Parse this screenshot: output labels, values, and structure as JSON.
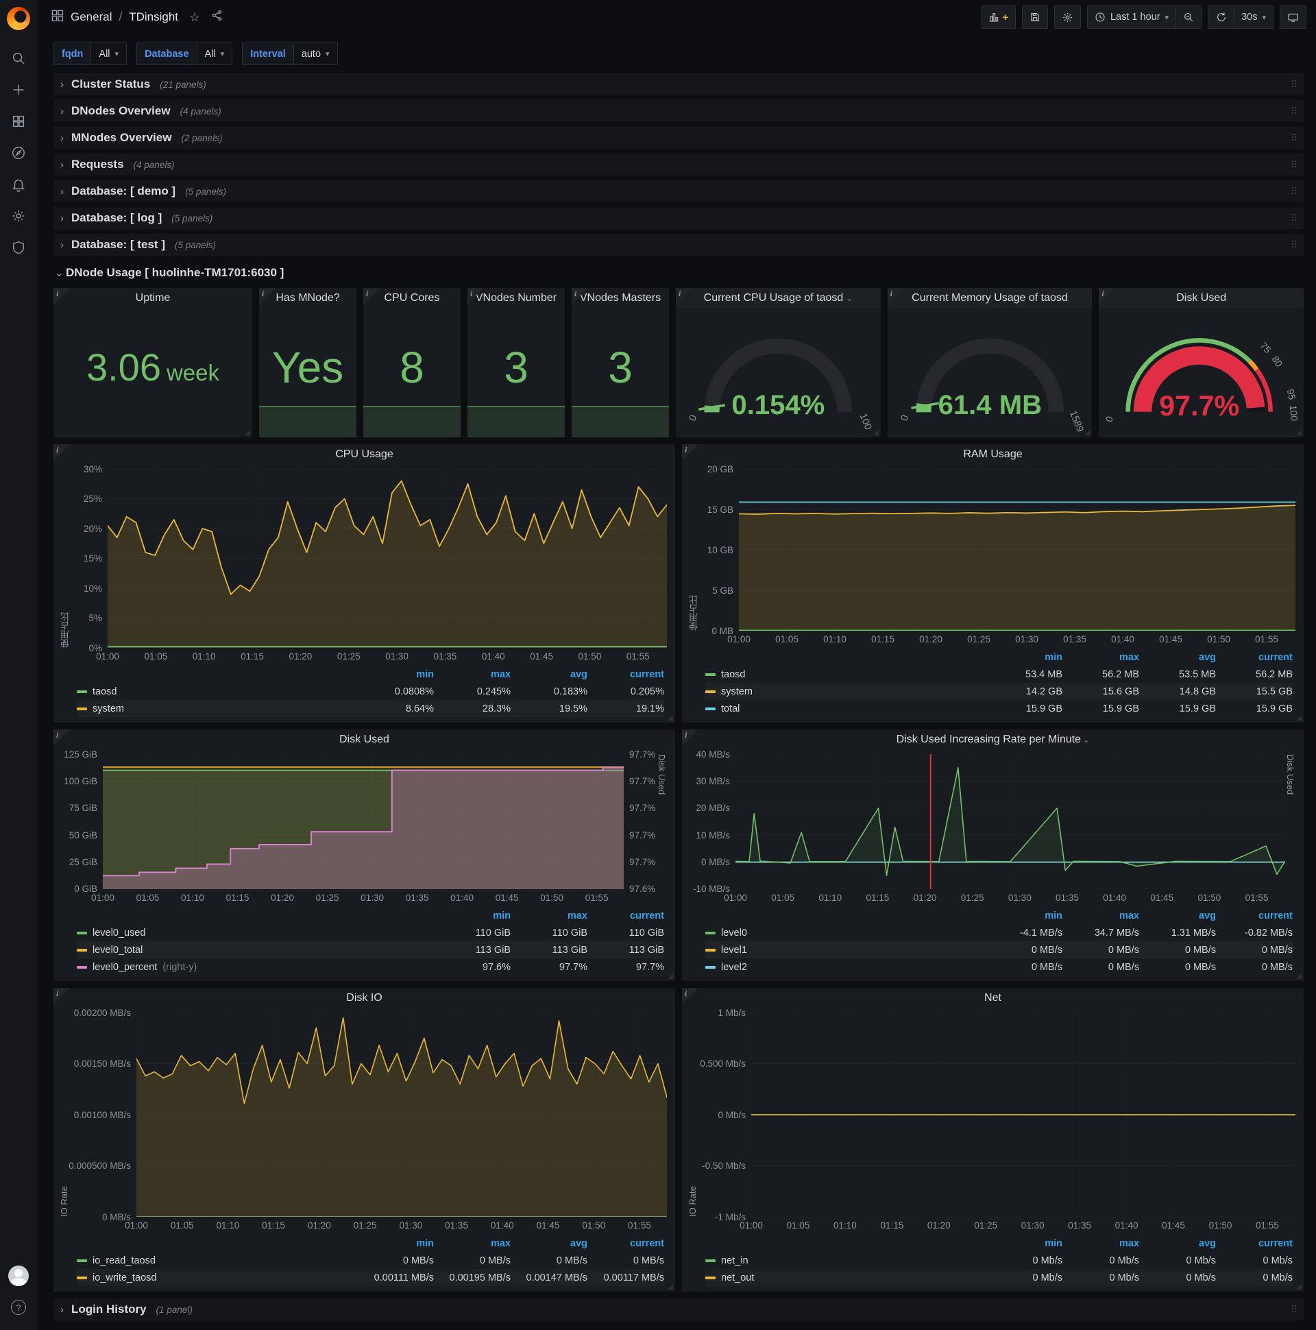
{
  "topbar": {
    "breadcrumb": {
      "section": "General",
      "separator": "/",
      "page": "TDinsight"
    },
    "time_range": "Last 1 hour",
    "refresh_interval": "30s"
  },
  "variables": [
    {
      "label": "fqdn",
      "value": "All"
    },
    {
      "label": "Database",
      "value": "All"
    },
    {
      "label": "Interval",
      "value": "auto"
    }
  ],
  "rows": [
    {
      "title": "Cluster Status",
      "count": "(21 panels)"
    },
    {
      "title": "DNodes Overview",
      "count": "(4 panels)"
    },
    {
      "title": "MNodes Overview",
      "count": "(2 panels)"
    },
    {
      "title": "Requests",
      "count": "(4 panels)"
    },
    {
      "title": "Database: [ demo ]",
      "count": "(5 panels)"
    },
    {
      "title": "Database: [ log ]",
      "count": "(5 panels)"
    },
    {
      "title": "Database: [ test ]",
      "count": "(5 panels)"
    }
  ],
  "dnode_row": {
    "title": "DNode Usage [ huolinhe-TM1701:6030 ]"
  },
  "login_row": {
    "title": "Login History",
    "count": "(1 panel)"
  },
  "stats": [
    {
      "title": "Uptime",
      "value": "3.06",
      "unit": "week"
    },
    {
      "title": "Has MNode?",
      "value": "Yes"
    },
    {
      "title": "CPU Cores",
      "value": "8"
    },
    {
      "title": "VNodes Number",
      "value": "3"
    },
    {
      "title": "VNodes Masters",
      "value": "3"
    }
  ],
  "gauges": [
    {
      "title": "Current CPU Usage of taosd",
      "value": "0.154%",
      "scale": [
        "0",
        "100"
      ],
      "color": "#73bf69"
    },
    {
      "title": "Current Memory Usage of taosd",
      "value": "61.4 MB",
      "scale": [
        "0",
        "1589"
      ],
      "color": "#73bf69"
    },
    {
      "title": "Disk Used",
      "value": "97.7%",
      "scale": [
        "0",
        "75",
        "80",
        "95",
        "100"
      ],
      "color": "#e02f44"
    }
  ],
  "legend_headers": [
    "min",
    "max",
    "avg",
    "current"
  ],
  "xticks": [
    "01:00",
    "01:05",
    "01:10",
    "01:15",
    "01:20",
    "01:25",
    "01:30",
    "01:35",
    "01:40",
    "01:45",
    "01:50",
    "01:55"
  ],
  "colors": {
    "green": "#73bf69",
    "yellow": "#eab839",
    "blue": "#6ed0e0",
    "magenta": "#d683ce",
    "red": "#e02f44",
    "link_blue": "#33a2e5"
  },
  "chart_data": [
    {
      "id": "cpu",
      "type": "line",
      "title": "CPU Usage",
      "ylabel": "使用占比",
      "yticks": [
        "30%",
        "25%",
        "20%",
        "15%",
        "10%",
        "5%",
        "0%"
      ],
      "ylim": [
        0,
        30
      ],
      "series": [
        {
          "name": "system",
          "color": "#eab839",
          "width": 1.8,
          "fill": 0.16,
          "values": [
            20.5,
            18.5,
            22,
            21,
            16,
            15.5,
            19,
            21.5,
            18,
            16.5,
            20,
            19.5,
            13.5,
            9,
            10.5,
            9.5,
            12,
            16.5,
            18.5,
            24.5,
            20,
            16,
            21,
            19.5,
            23.5,
            25,
            20.5,
            19,
            22,
            17.5,
            26,
            28,
            24,
            20.5,
            21.5,
            17,
            20,
            23.5,
            27.5,
            22,
            19,
            21,
            25.5,
            19.5,
            18,
            22.5,
            17.5,
            21,
            24.5,
            20,
            26.5,
            22,
            18.5,
            21,
            23.5,
            20.5,
            27,
            25,
            22,
            24
          ]
        },
        {
          "name": "taosd",
          "color": "#73bf69",
          "width": 1.8,
          "fill": 0.12,
          "values": [
            0.2,
            0.2
          ]
        }
      ],
      "legend": {
        "rows": [
          {
            "name": "taosd",
            "color": "#73bf69",
            "values": [
              "0.0808%",
              "0.245%",
              "0.183%",
              "0.205%"
            ]
          },
          {
            "name": "system",
            "color": "#eab839",
            "values": [
              "8.64%",
              "28.3%",
              "19.5%",
              "19.1%"
            ]
          }
        ]
      }
    },
    {
      "id": "ram",
      "type": "line",
      "title": "RAM Usage",
      "ylabel": "使用占比",
      "yticks": [
        "20 GB",
        "15 GB",
        "10 GB",
        "5 GB",
        "0 MB"
      ],
      "ylim": [
        0,
        20
      ],
      "series": [
        {
          "name": "system",
          "color": "#eab839",
          "width": 1.8,
          "fill": 0.16,
          "values": [
            14.45,
            14.4,
            14.5,
            14.45,
            14.5,
            14.42,
            14.48,
            14.52,
            14.47,
            14.5,
            14.55,
            14.5,
            14.58,
            14.52,
            14.6,
            14.55,
            14.62,
            14.68,
            14.6,
            14.72,
            14.78,
            14.72,
            14.82,
            14.9,
            14.98,
            15.05,
            15.15,
            15.28,
            15.42,
            15.5
          ]
        },
        {
          "name": "total",
          "color": "#6ed0e0",
          "width": 1.8,
          "fill": 0,
          "values": [
            15.9,
            15.9
          ]
        },
        {
          "name": "taosd",
          "color": "#73bf69",
          "width": 1.8,
          "fill": 0,
          "values": [
            0.05,
            0.05
          ]
        }
      ],
      "legend": {
        "rows": [
          {
            "name": "taosd",
            "color": "#73bf69",
            "values": [
              "53.4 MB",
              "56.2 MB",
              "53.5 MB",
              "56.2 MB"
            ]
          },
          {
            "name": "system",
            "color": "#eab839",
            "values": [
              "14.2 GB",
              "15.6 GB",
              "14.8 GB",
              "15.5 GB"
            ]
          },
          {
            "name": "total",
            "color": "#6ed0e0",
            "values": [
              "15.9 GB",
              "15.9 GB",
              "15.9 GB",
              "15.9 GB"
            ]
          }
        ]
      }
    },
    {
      "id": "disk",
      "type": "line",
      "title": "Disk Used",
      "yticks": [
        "125 GiB",
        "100 GiB",
        "75 GiB",
        "50 GiB",
        "25 GiB",
        "0 GiB"
      ],
      "yticks_right": [
        "97.7%",
        "97.7%",
        "97.7%",
        "97.7%",
        "97.7%",
        "97.6%"
      ],
      "ylabel_right": "Disk Used",
      "ylim": [
        0,
        125
      ],
      "series": [
        {
          "name": "level0_total",
          "color": "#eab839",
          "width": 1.8,
          "fill": 0.16,
          "values": [
            113,
            113
          ]
        },
        {
          "name": "level0_used",
          "color": "#73bf69",
          "width": 1.8,
          "fill": 0.16,
          "values": [
            110,
            110
          ]
        },
        {
          "name": "level0_percent",
          "color": "#d683ce",
          "width": 2,
          "fill": 0.3,
          "norm": true,
          "points": [
            [
              0,
              0.1
            ],
            [
              0.07,
              0.1
            ],
            [
              0.07,
              0.125
            ],
            [
              0.14,
              0.125
            ],
            [
              0.14,
              0.155
            ],
            [
              0.2,
              0.155
            ],
            [
              0.2,
              0.185
            ],
            [
              0.245,
              0.185
            ],
            [
              0.245,
              0.3
            ],
            [
              0.3,
              0.3
            ],
            [
              0.3,
              0.33
            ],
            [
              0.4,
              0.33
            ],
            [
              0.4,
              0.425
            ],
            [
              0.555,
              0.425
            ],
            [
              0.555,
              0.88
            ],
            [
              0.96,
              0.88
            ],
            [
              0.96,
              0.9
            ],
            [
              1,
              0.9
            ]
          ]
        }
      ],
      "legend": {
        "cols": [
          "min",
          "max",
          "current"
        ],
        "rows": [
          {
            "name": "level0_used",
            "color": "#73bf69",
            "values": [
              "110 GiB",
              "110 GiB",
              "110 GiB"
            ]
          },
          {
            "name": "level0_total",
            "color": "#eab839",
            "values": [
              "113 GiB",
              "113 GiB",
              "113 GiB"
            ]
          },
          {
            "name": "level0_percent",
            "suffix": "(right-y)",
            "color": "#d683ce",
            "values": [
              "97.6%",
              "97.7%",
              "97.7%"
            ]
          }
        ]
      }
    },
    {
      "id": "rate",
      "type": "line",
      "title": "Disk Used Increasing Rate per Minute",
      "has_menu": true,
      "yticks": [
        "40 MB/s",
        "30 MB/s",
        "20 MB/s",
        "10 MB/s",
        "0 MB/s",
        "-10 MB/s"
      ],
      "ylabel_right": "Disk Used",
      "ylim": [
        -10,
        40
      ],
      "annotations": [
        {
          "x": 0.355,
          "color": "#e02f44"
        }
      ],
      "series": [
        {
          "name": "level1",
          "color": "#eab839",
          "width": 1.6,
          "fill": 0,
          "values": [
            0,
            0
          ]
        },
        {
          "name": "level2",
          "color": "#6ed0e0",
          "width": 1.6,
          "fill": 0,
          "values": [
            0,
            0
          ]
        },
        {
          "name": "level0",
          "color": "#73bf69",
          "width": 1.6,
          "fill": 0.1,
          "points": [
            [
              0,
              0.3
            ],
            [
              0.025,
              0.2
            ],
            [
              0.034,
              18
            ],
            [
              0.045,
              0.4
            ],
            [
              0.1,
              -0.3
            ],
            [
              0.12,
              11
            ],
            [
              0.135,
              0.2
            ],
            [
              0.2,
              0.2
            ],
            [
              0.26,
              20
            ],
            [
              0.275,
              -5
            ],
            [
              0.29,
              13
            ],
            [
              0.305,
              0.3
            ],
            [
              0.37,
              0.2
            ],
            [
              0.405,
              35
            ],
            [
              0.42,
              0.3
            ],
            [
              0.5,
              0.2
            ],
            [
              0.585,
              20
            ],
            [
              0.6,
              -3
            ],
            [
              0.615,
              0.3
            ],
            [
              0.7,
              0.2
            ],
            [
              0.73,
              -1.5
            ],
            [
              0.8,
              0.3
            ],
            [
              0.9,
              0.2
            ],
            [
              0.965,
              6
            ],
            [
              0.985,
              -4.5
            ],
            [
              1,
              0.4
            ]
          ]
        }
      ],
      "legend": {
        "rows": [
          {
            "name": "level0",
            "color": "#73bf69",
            "values": [
              "-4.1 MB/s",
              "34.7 MB/s",
              "1.31 MB/s",
              "-0.82 MB/s"
            ]
          },
          {
            "name": "level1",
            "color": "#eab839",
            "values": [
              "0 MB/s",
              "0 MB/s",
              "0 MB/s",
              "0 MB/s"
            ]
          },
          {
            "name": "level2",
            "color": "#6ed0e0",
            "values": [
              "0 MB/s",
              "0 MB/s",
              "0 MB/s",
              "0 MB/s"
            ]
          }
        ]
      }
    },
    {
      "id": "io",
      "type": "line",
      "title": "Disk IO",
      "ylabel": "IO Rate",
      "yticks": [
        "0.00200 MB/s",
        "0.00150 MB/s",
        "0.00100 MB/s",
        "0.000500 MB/s",
        "0 MB/s"
      ],
      "ylim": [
        0,
        0.002
      ],
      "series": [
        {
          "name": "io_write_taosd",
          "color": "#eab839",
          "width": 1.6,
          "fill": 0.16,
          "values": [
            0.00155,
            0.00138,
            0.00142,
            0.00136,
            0.0014,
            0.00158,
            0.00148,
            0.00152,
            0.00143,
            0.00156,
            0.00149,
            0.0016,
            0.00111,
            0.00145,
            0.00168,
            0.00132,
            0.00154,
            0.00126,
            0.00161,
            0.0015,
            0.00185,
            0.00138,
            0.00148,
            0.00195,
            0.0013,
            0.0015,
            0.00139,
            0.00168,
            0.00142,
            0.0016,
            0.00133,
            0.00152,
            0.00175,
            0.00141,
            0.00154,
            0.00148,
            0.0013,
            0.00158,
            0.00145,
            0.00168,
            0.00137,
            0.0015,
            0.0016,
            0.00128,
            0.00148,
            0.00155,
            0.00135,
            0.00192,
            0.00145,
            0.0013,
            0.00156,
            0.0015,
            0.0014,
            0.00162,
            0.00148,
            0.00135,
            0.00158,
            0.00132,
            0.0015,
            0.00117
          ]
        },
        {
          "name": "io_read_taosd",
          "color": "#73bf69",
          "width": 1.6,
          "fill": 0,
          "values": [
            0,
            0
          ]
        }
      ],
      "legend": {
        "rows": [
          {
            "name": "io_read_taosd",
            "color": "#73bf69",
            "values": [
              "0 MB/s",
              "0 MB/s",
              "0 MB/s",
              "0 MB/s"
            ]
          },
          {
            "name": "io_write_taosd",
            "color": "#eab839",
            "values": [
              "0.00111 MB/s",
              "0.00195 MB/s",
              "0.00147 MB/s",
              "0.00117 MB/s"
            ]
          }
        ]
      }
    },
    {
      "id": "net",
      "type": "line",
      "title": "Net",
      "ylabel": "IO Rate",
      "yticks": [
        "1 Mb/s",
        "0.500 Mb/s",
        "0 Mb/s",
        "-0.50 Mb/s",
        "-1 Mb/s"
      ],
      "ylim": [
        -1,
        1
      ],
      "series": [
        {
          "name": "net_in",
          "color": "#73bf69",
          "width": 1.6,
          "fill": 0,
          "values": [
            0,
            0
          ]
        },
        {
          "name": "net_out",
          "color": "#eab839",
          "width": 1.6,
          "fill": 0,
          "values": [
            0,
            0
          ]
        }
      ],
      "legend": {
        "rows": [
          {
            "name": "net_in",
            "color": "#73bf69",
            "values": [
              "0 Mb/s",
              "0 Mb/s",
              "0 Mb/s",
              "0 Mb/s"
            ]
          },
          {
            "name": "net_out",
            "color": "#eab839",
            "values": [
              "0 Mb/s",
              "0 Mb/s",
              "0 Mb/s",
              "0 Mb/s"
            ]
          }
        ]
      }
    }
  ]
}
